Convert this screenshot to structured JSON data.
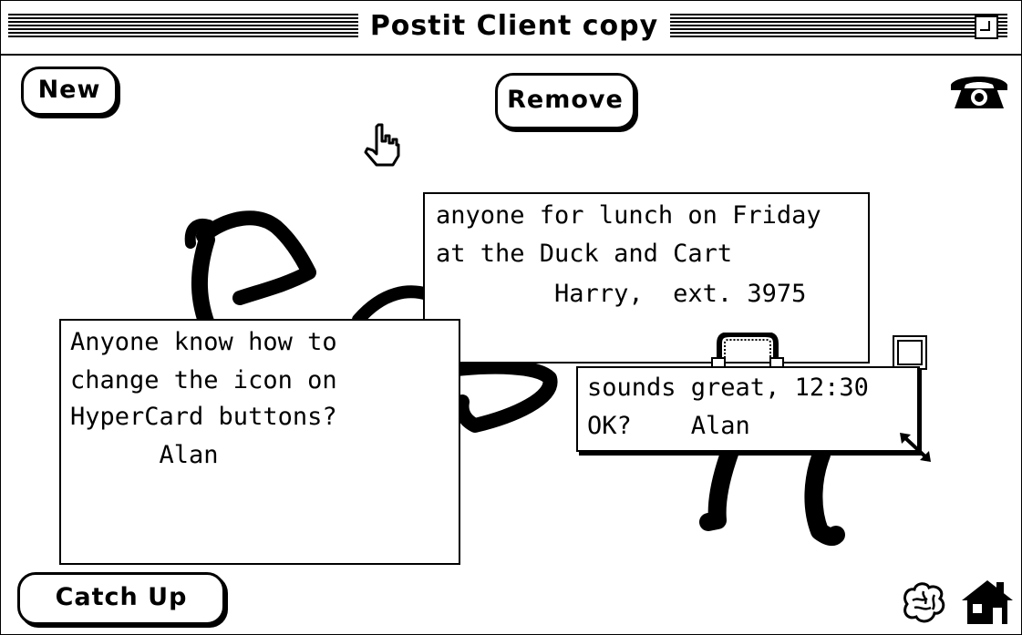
{
  "window": {
    "title": "Postit Client copy"
  },
  "buttons": {
    "new": "New",
    "remove": "Remove",
    "catch_up": "Catch Up"
  },
  "icons": {
    "phone": "telephone-icon",
    "pointer": "hand-pointer-icon",
    "brain": "brain-icon",
    "home": "home-icon",
    "close": "close-box-icon",
    "resize": "resize-arrows-icon"
  },
  "notes": [
    {
      "lines": [
        "anyone for lunch on Friday",
        "at the Duck and Cart",
        "        Harry,  ext. 3975"
      ]
    },
    {
      "lines": [
        "Anyone know how to",
        "change the icon on",
        "HyperCard buttons?",
        "      Alan"
      ]
    },
    {
      "lines": [
        "sounds great, 12:30",
        "OK?    Alan"
      ]
    }
  ]
}
